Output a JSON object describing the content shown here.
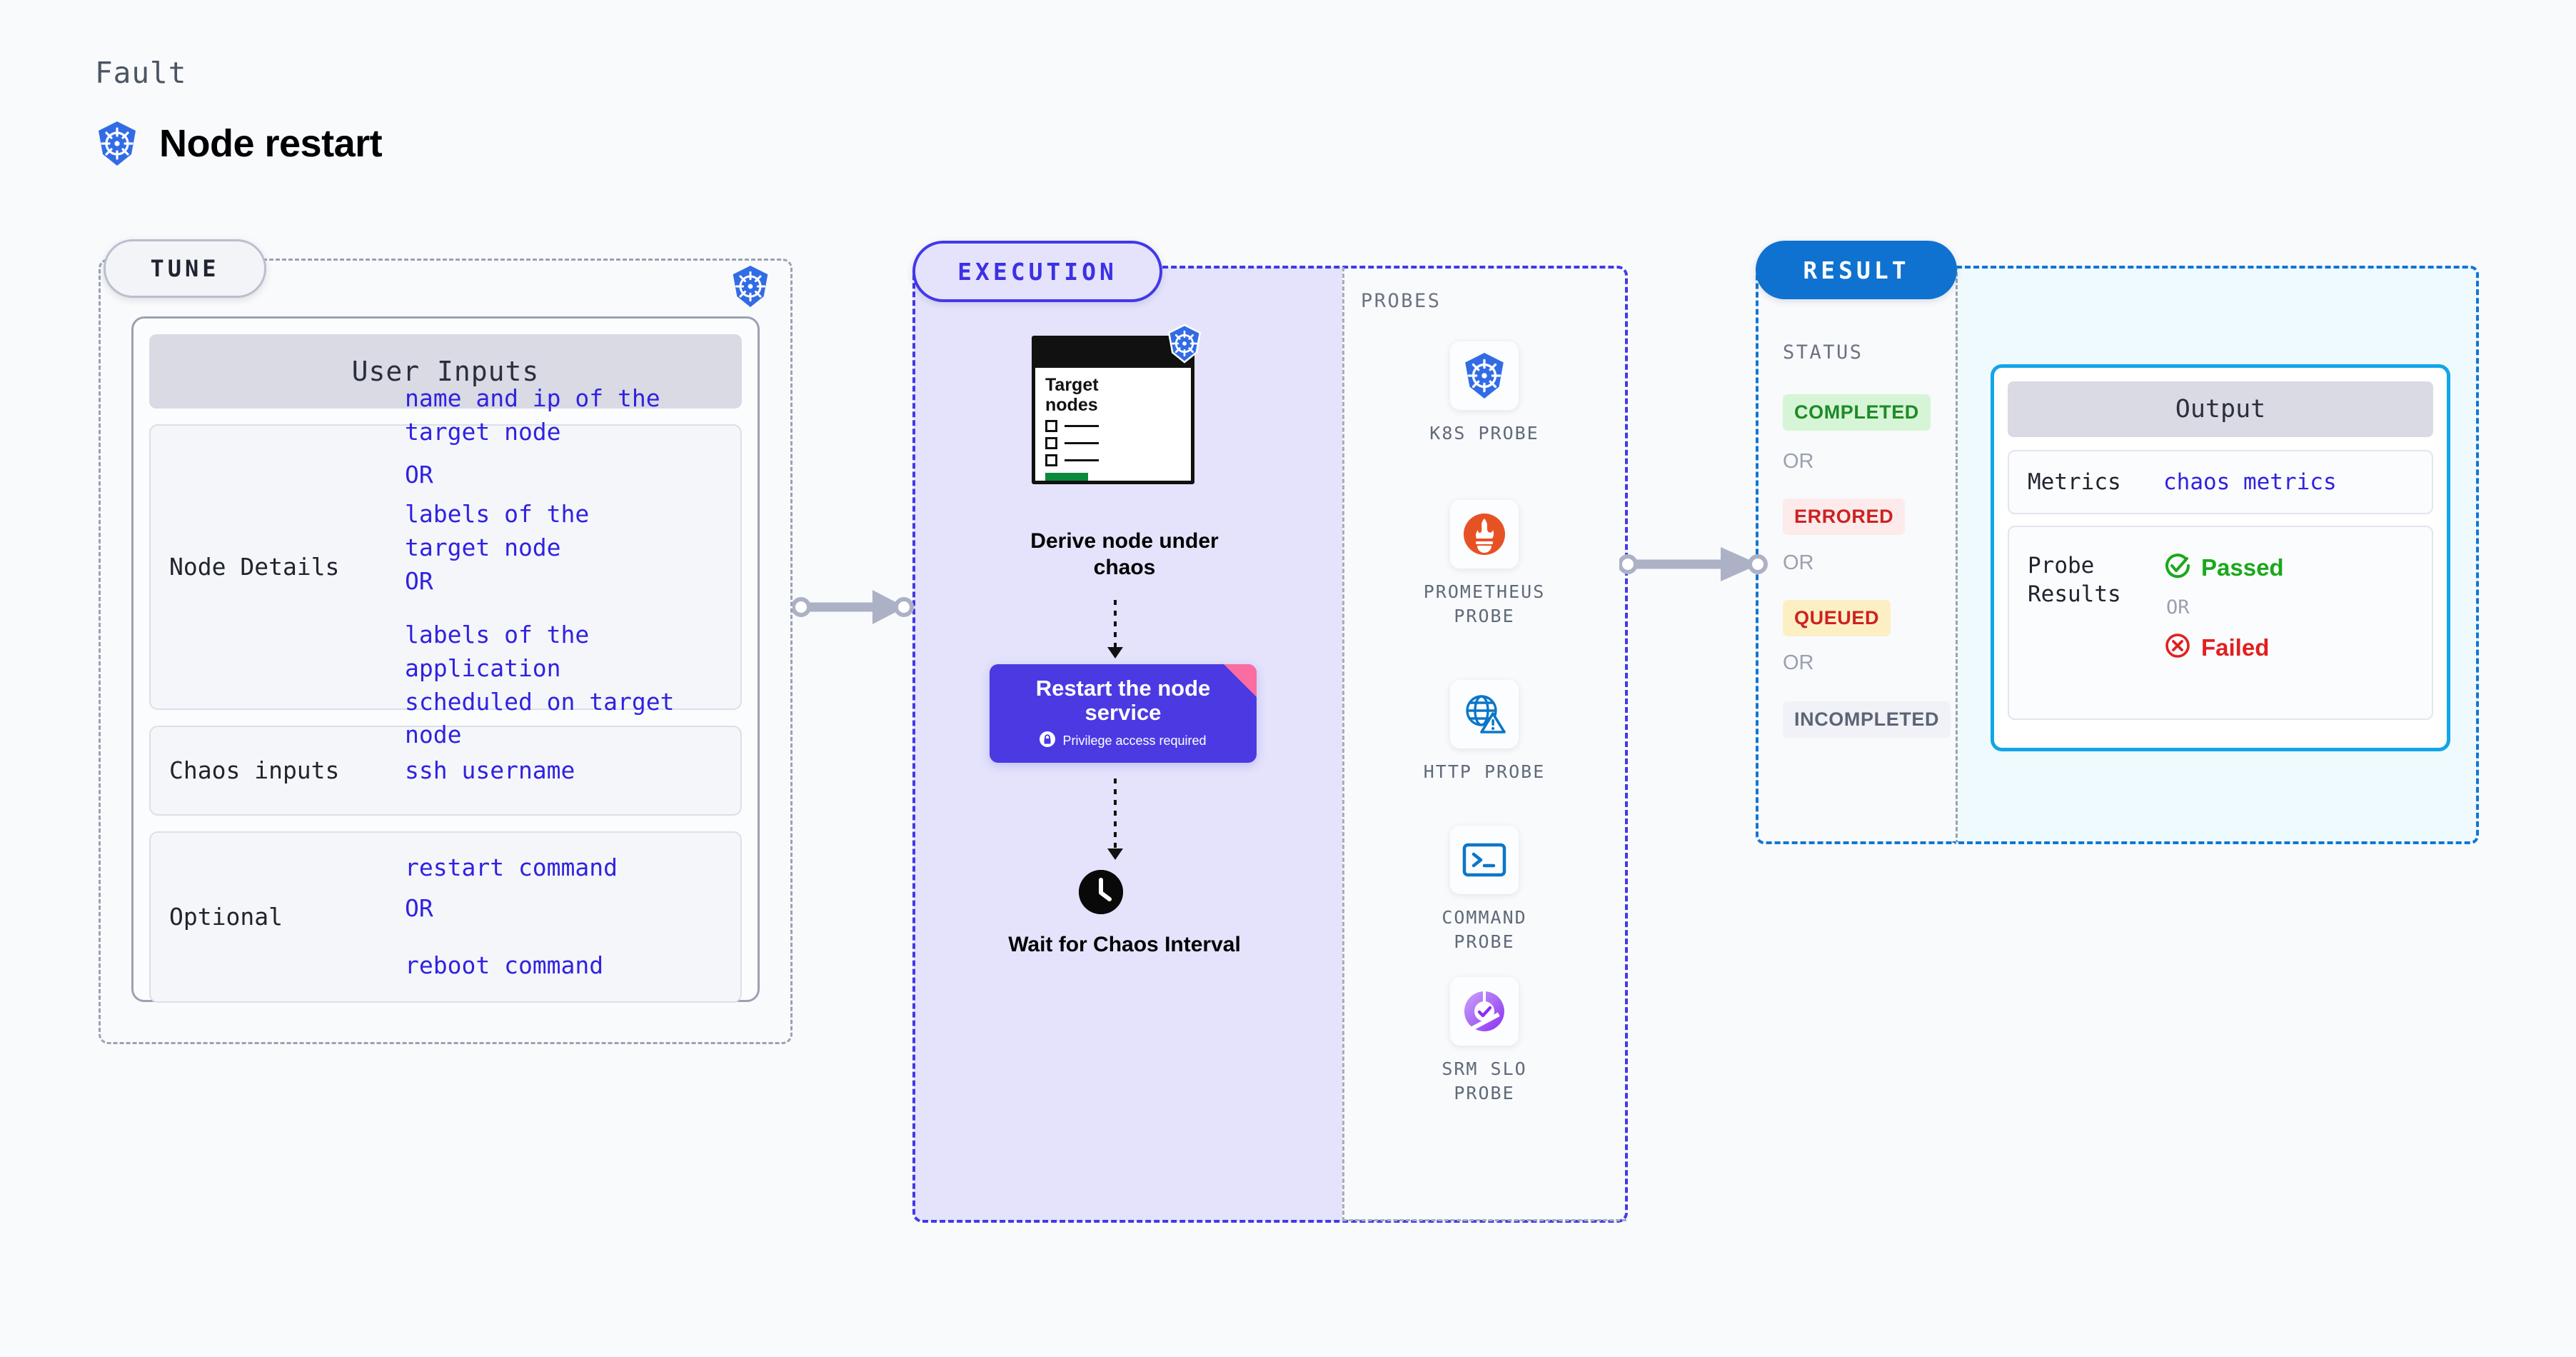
{
  "header": {
    "fault_label": "Fault",
    "title": "Node restart",
    "icon": "kubernetes-icon"
  },
  "tune": {
    "tag": "TUNE",
    "badge_icon": "kubernetes-icon",
    "card_header": "User Inputs",
    "rows": [
      {
        "key": "Node Details",
        "value_line1": "name and ip of the\ntarget node",
        "or1": "OR",
        "value_line2": "labels of the\ntarget node",
        "or2": "OR",
        "value_line3": "labels of the application\n scheduled on target node"
      },
      {
        "key": "Chaos inputs",
        "value_line1": "ssh username"
      },
      {
        "key": "Optional",
        "value_line1": "restart command",
        "or1": "OR",
        "value_line2": "reboot command"
      }
    ]
  },
  "execution": {
    "tag": "EXECUTION",
    "target_card": {
      "title": "Target\nnodes",
      "badge_icon": "kubernetes-icon",
      "checkbox_rows": 3
    },
    "derive_label": "Derive node under\nchaos",
    "restart_step": {
      "title": "Restart the node\nservice",
      "subtitle": "Privilege access required",
      "lock_icon": "lock-icon",
      "ribbon_icon": "chaos-ribbon-icon"
    },
    "wait_step": {
      "icon": "clock-icon",
      "label": "Wait for Chaos\nInterval"
    },
    "probes_label": "PROBES",
    "probes": [
      {
        "name": "K8S  PROBE",
        "icon": "kubernetes-icon"
      },
      {
        "name": "PROMETHEUS\nPROBE",
        "icon": "prometheus-icon"
      },
      {
        "name": "HTTP  PROBE",
        "icon": "http-globe-warning-icon"
      },
      {
        "name": "COMMAND\nPROBE",
        "icon": "terminal-icon"
      },
      {
        "name": "SRM  SLO\nPROBE",
        "icon": "srm-slo-donut-icon"
      }
    ]
  },
  "result": {
    "tag": "RESULT",
    "status_label": "STATUS",
    "statuses": [
      {
        "label": "COMPLETED",
        "bg": "#d6f5d6",
        "fg": "#1e8a27"
      },
      {
        "label": "ERRORED",
        "bg": "#fdeaea",
        "fg": "#cc2222"
      },
      {
        "label": "QUEUED",
        "bg": "#fdefc4",
        "fg": "#cc2222"
      },
      {
        "label": "INCOMPLETED",
        "bg": "#f1f2f7",
        "fg": "#5c6475"
      }
    ],
    "or_label": "OR",
    "output": {
      "header": "Output",
      "metrics_key": "Metrics",
      "metrics_value": "chaos metrics",
      "probe_results_key": "Probe\nResults",
      "passed_label": "Passed",
      "passed_icon": "check-circle-icon",
      "or_label": "OR",
      "failed_label": "Failed",
      "failed_icon": "x-circle-icon"
    }
  },
  "connectors": {
    "arrow1_icon": "arrow-right-icon",
    "arrow2_icon": "arrow-right-icon"
  },
  "colors": {
    "k8s_blue": "#326ce5",
    "exec_purple": "#4338e8",
    "result_blue": "#0f72d0",
    "output_cyan": "#12a5e8",
    "value_indigo": "#3022e0"
  }
}
